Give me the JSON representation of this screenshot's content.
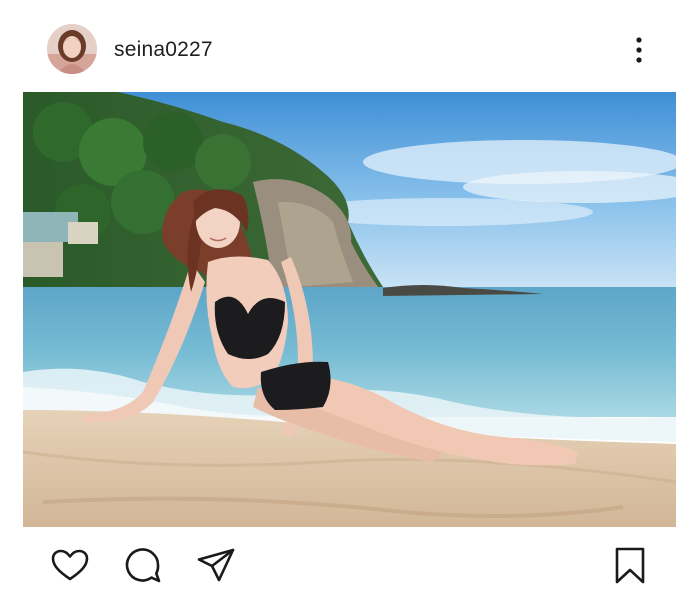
{
  "post": {
    "username": "seina0227"
  },
  "icons": {
    "more": "more-options-icon",
    "like": "heart-icon",
    "comment": "comment-icon",
    "share": "send-icon",
    "save": "bookmark-icon"
  },
  "colors": {
    "icon": "#1a1a1a",
    "text": "#1f1f1f",
    "background": "#ffffff"
  }
}
